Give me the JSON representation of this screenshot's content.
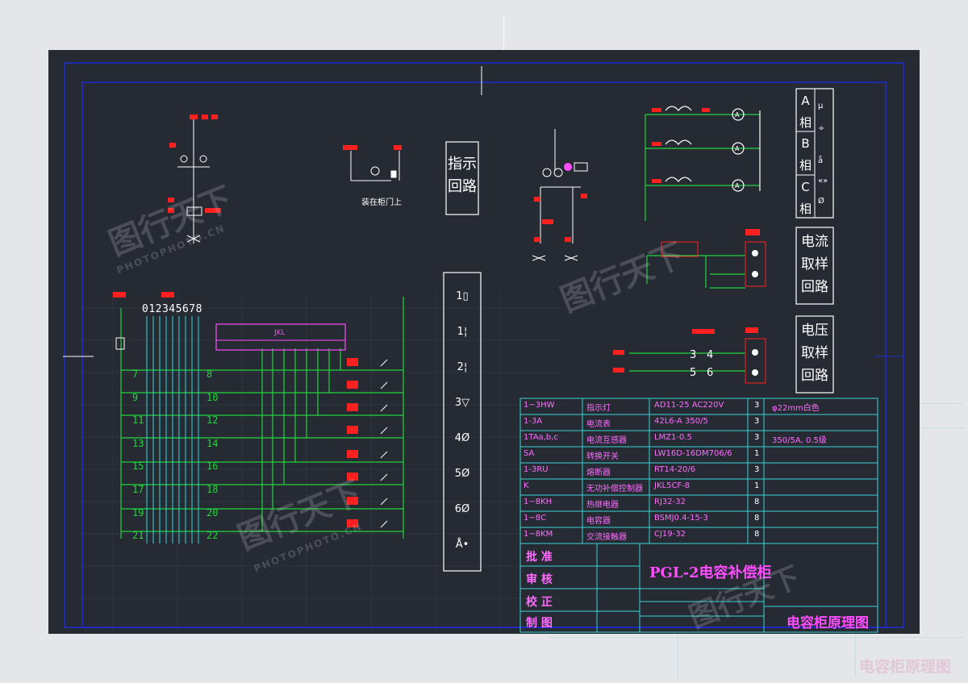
{
  "page_title": "电容柜原理图",
  "panels": {
    "indicator_circuit": "指示回路",
    "current_sampling": "电流取样回路",
    "voltage_sampling": "电压取样回路",
    "phase_a": "A相",
    "phase_b": "B相",
    "phase_c": "C相",
    "indicator_note": "装在柜门上"
  },
  "bom": [
    {
      "code": "1~3HW",
      "name": "指示灯",
      "model": "AD11-25 AC220V",
      "qty": "3",
      "note": "φ22mm白色"
    },
    {
      "code": "1-3A",
      "name": "电流表",
      "model": "42L6-A 350/5",
      "qty": "3",
      "note": ""
    },
    {
      "code": "1TAa,b,c",
      "name": "电流互感器",
      "model": "LMZ1-0.5",
      "qty": "3",
      "note": "350/5A, 0.5级"
    },
    {
      "code": "SA",
      "name": "转换开关",
      "model": "LW16D-16DM706/6",
      "qty": "1",
      "note": ""
    },
    {
      "code": "1-3RU",
      "name": "熔断器",
      "model": "RT14-20/6",
      "qty": "3",
      "note": ""
    },
    {
      "code": "K",
      "name": "无功补偿控制器",
      "model": "JKL5CF-8",
      "qty": "1",
      "note": ""
    },
    {
      "code": "1~8KH",
      "name": "热继电器",
      "model": "RJ32-32",
      "qty": "8",
      "note": ""
    },
    {
      "code": "1~8C",
      "name": "电容器",
      "model": "BSMJ0.4-15-3",
      "qty": "8",
      "note": ""
    },
    {
      "code": "1~8KM",
      "name": "交流接触器",
      "model": "CJ19-32",
      "qty": "8",
      "note": ""
    }
  ],
  "title_block": {
    "product": "PGL-2电容补偿柜",
    "approve": "批 准",
    "review": "审 核",
    "check": "校 正",
    "draw": "制 图",
    "drawing_name": "电容柜原理图"
  },
  "terminals": {
    "left": [
      "7",
      "9",
      "11",
      "13",
      "15",
      "17",
      "19",
      "21"
    ],
    "right": [
      "8",
      "10",
      "12",
      "14",
      "16",
      "18",
      "20",
      "22"
    ],
    "bus_digits": "012345678",
    "controller": "JKL",
    "switch_glyphs": [
      "1▯",
      "1¦",
      "2¦",
      "3▽",
      "4Ø",
      "5Ø",
      "6Ø",
      "Å•"
    ]
  },
  "voltage_terminals": [
    "3",
    "4",
    "5",
    "6"
  ],
  "watermarks": [
    "图行天下",
    "PHOTOPHOTO.CN"
  ],
  "colors": {
    "background": "#262a33",
    "frame": "#1f2bd6",
    "wire": "#21d53b",
    "label_red": "#ff2020",
    "cyan": "#35d6d6",
    "magenta": "#ff4dff"
  }
}
